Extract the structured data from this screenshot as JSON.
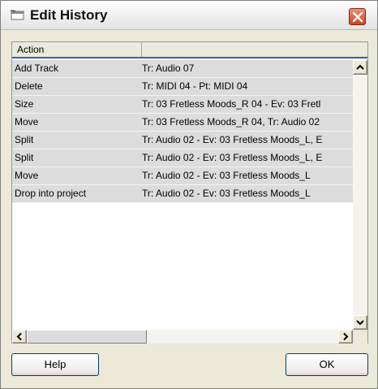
{
  "window": {
    "title": "Edit History",
    "icon": "app-window-icon",
    "close_icon": "close-icon"
  },
  "table": {
    "columns": [
      "Action",
      ""
    ],
    "rows": [
      {
        "action": "Add Track",
        "detail": "Tr: Audio 07"
      },
      {
        "action": "Delete",
        "detail": "Tr: MIDI 04 - Pt: MIDI 04"
      },
      {
        "action": "Size",
        "detail": "Tr: 03 Fretless Moods_R 04 - Ev: 03 Fretl"
      },
      {
        "action": "Move",
        "detail": "Tr: 03 Fretless Moods_R 04, Tr: Audio 02"
      },
      {
        "action": "Split",
        "detail": "Tr: Audio 02 - Ev: 03 Fretless Moods_L, E"
      },
      {
        "action": "Split",
        "detail": "Tr: Audio 02 - Ev: 03 Fretless Moods_L, E"
      },
      {
        "action": "Move",
        "detail": "Tr: Audio 02 - Ev: 03 Fretless Moods_L"
      },
      {
        "action": "Drop into project",
        "detail": "Tr: Audio 02 - Ev: 03 Fretless Moods_L"
      }
    ]
  },
  "buttons": {
    "help": "Help",
    "ok": "OK"
  },
  "colors": {
    "header_underline": "#3d57c6",
    "row_background": "#dcdcdc",
    "close_button": "#d44221"
  }
}
